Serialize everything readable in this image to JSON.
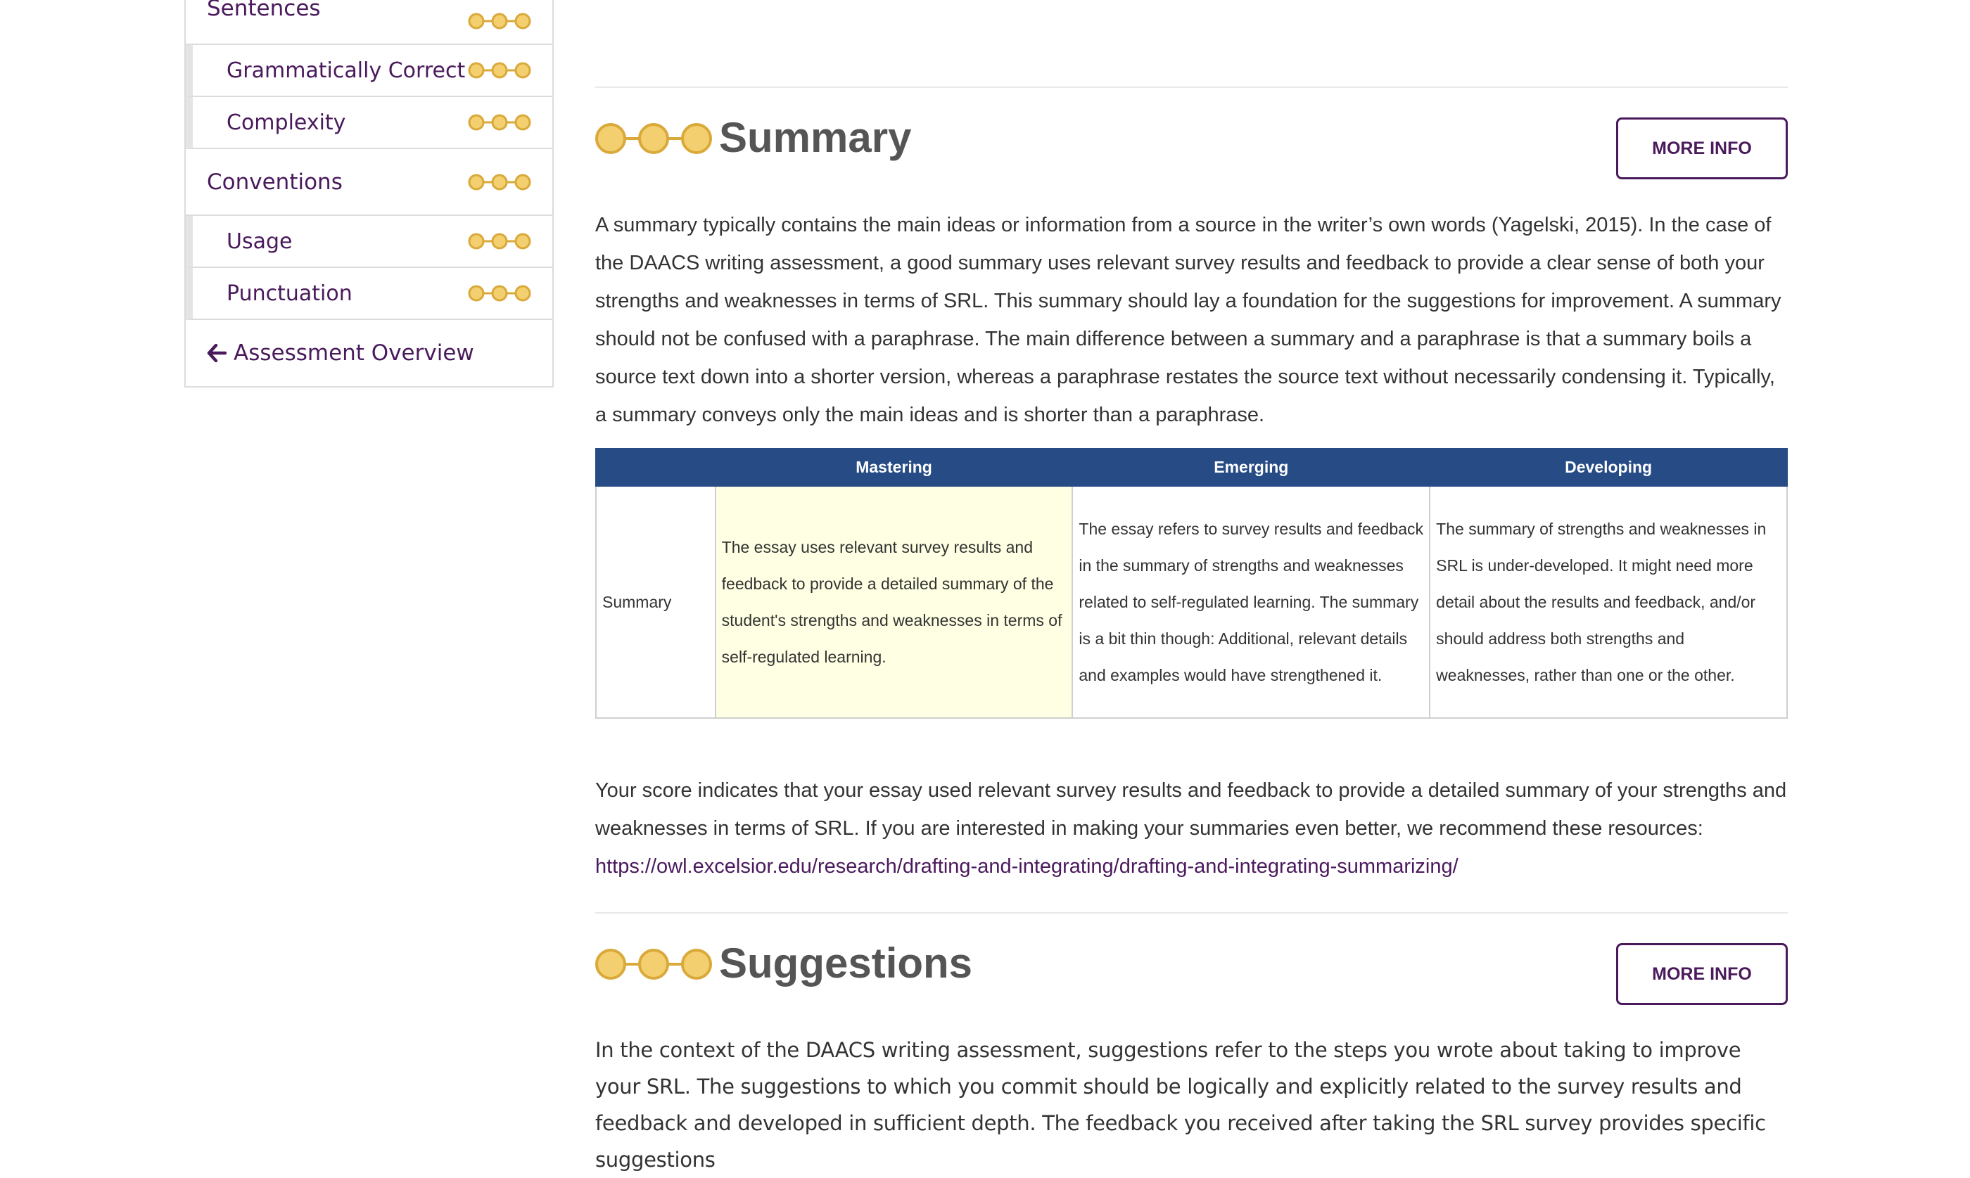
{
  "sidebar": {
    "items": [
      {
        "label": "Sentences",
        "level": "top"
      },
      {
        "label": "Grammatically Correct",
        "level": "sub"
      },
      {
        "label": "Complexity",
        "level": "sub"
      },
      {
        "label": "Conventions",
        "level": "top"
      },
      {
        "label": "Usage",
        "level": "sub"
      },
      {
        "label": "Punctuation",
        "level": "sub"
      }
    ],
    "back_link": "Assessment Overview"
  },
  "summary": {
    "title": "Summary",
    "more_info": "MORE INFO",
    "intro": "A summary typically contains the main ideas or information from a source in the writer’s own words (Yagelski, 2015). In the case of the DAACS writing assessment, a good summary uses relevant survey results and feedback to provide a clear sense of both your strengths and weaknesses in terms of SRL. This summary should lay a foundation for the suggestions for improvement. A summary should not be confused with a paraphrase. The main difference between a summary and a paraphrase is that a summary boils a source text down into a shorter version, whereas a paraphrase restates the source text without necessarily condensing it. Typically, a summary conveys only the main ideas and is shorter than a paraphrase.",
    "rubric": {
      "headers": [
        "",
        "Mastering",
        "Emerging",
        "Developing"
      ],
      "row_label": "Summary",
      "cells": [
        "The essay uses relevant survey results and feedback to provide a detailed summary of the student's strengths and weaknesses in terms of self-regulated learning.",
        "The essay refers to survey results and feedback in the summary of strengths and weaknesses related to self-regulated learning. The summary is a bit thin though: Additional, relevant details and examples would have strengthened it.",
        "The summary of strengths and weaknesses in SRL is under-developed. It might need more detail about the results and feedback, and/or should address both strengths and weaknesses, rather than one or the other."
      ]
    },
    "score_text": "Your score indicates that your essay used relevant survey results and feedback to provide a detailed summary of your strengths and weaknesses in terms of SRL. If you are interested in making your summaries even better, we recommend these resources:",
    "resource_link": "https://owl.excelsior.edu/research/drafting-and-integrating/drafting-and-integrating-summarizing/"
  },
  "suggestions": {
    "title": "Suggestions",
    "more_info": "MORE INFO",
    "intro": "In the context of the DAACS writing assessment, suggestions refer to the steps you wrote about taking to improve your SRL. The suggestions to which you commit should be logically and explicitly related to the survey results and feedback and developed in sufficient depth. The feedback you received after taking the SRL survey provides specific suggestions"
  },
  "colors": {
    "brand_purple": "#4a1a5c",
    "table_header": "#264b85",
    "highlight": "#ffffe3",
    "dot_fill": "#f3cf6f",
    "dot_stroke": "#d9a93a"
  },
  "icons": {
    "level_indicator": "three-dots-mastery-icon",
    "back": "arrow-left-icon"
  }
}
